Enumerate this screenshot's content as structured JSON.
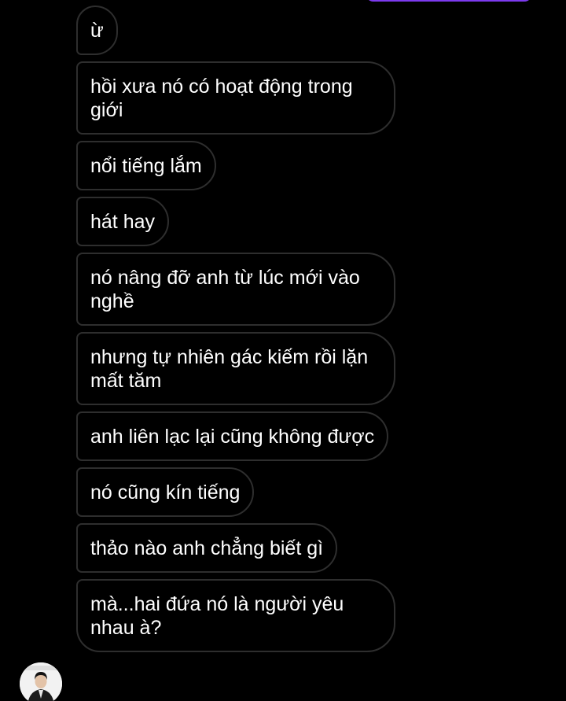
{
  "thread": {
    "messages": [
      {
        "text": "ừ"
      },
      {
        "text": "hồi xưa nó có hoạt động trong giới"
      },
      {
        "text": "nổi tiếng lắm"
      },
      {
        "text": "hát hay"
      },
      {
        "text": "nó nâng đỡ anh từ lúc mới vào nghề"
      },
      {
        "text": "nhưng tự nhiên gác kiếm rồi lặn mất tăm"
      },
      {
        "text": "anh liên lạc lại cũng không được"
      },
      {
        "text": "nó cũng kín tiếng"
      },
      {
        "text": "thảo nào anh chẳng biết gì"
      },
      {
        "text": "mà...hai đứa nó là người yêu nhau à?"
      }
    ]
  },
  "colors": {
    "background": "#000000",
    "bubble_border": "#2e2e2e",
    "text": "#ffffff",
    "sent_accent": "#7c3aed"
  },
  "icons": {
    "avatar": "sender-avatar-photo"
  }
}
